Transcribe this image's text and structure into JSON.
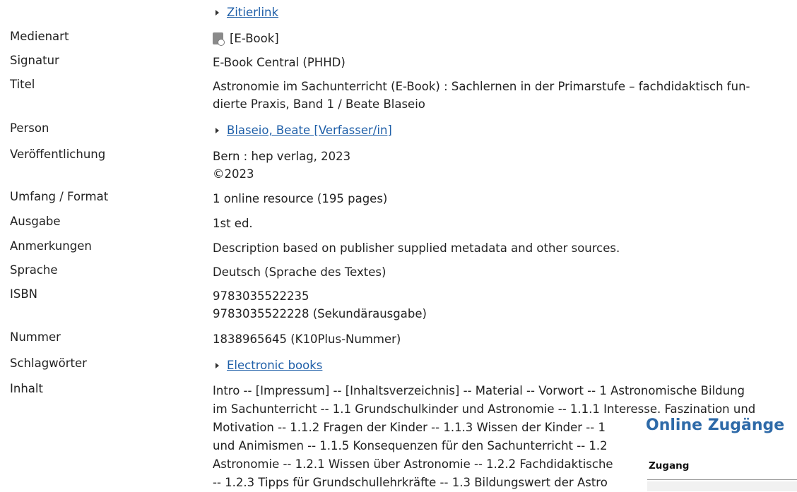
{
  "zitierlink": "Zitierlink",
  "fields": [
    {
      "label": "Medienart",
      "lines": [
        "[E-Book]"
      ],
      "icon": "ebook-icon"
    },
    {
      "label": "Signatur",
      "lines": [
        "E-Book Central (PHHD)"
      ]
    },
    {
      "label": "Titel",
      "lines": [
        "Astronomie im Sachunterricht (E-Book) : Sachlernen in der Primarstufe – fachdidaktisch fun-",
        "dierte Praxis, Band 1 / Beate Blaseio"
      ]
    },
    {
      "label": "Person",
      "link": "Blaseio, Beate [Verfasser/in]"
    },
    {
      "label": "Veröffentlichung",
      "lines": [
        "Bern : hep verlag, 2023",
        "©2023"
      ]
    },
    {
      "label": "Umfang / Format",
      "lines": [
        "1 online resource (195 pages)"
      ]
    },
    {
      "label": "Ausgabe",
      "lines": [
        "1st ed."
      ]
    },
    {
      "label": "Anmerkungen",
      "lines": [
        "Description based on publisher supplied metadata and other sources."
      ]
    },
    {
      "label": "Sprache",
      "lines": [
        "Deutsch (Sprache des Textes)"
      ]
    },
    {
      "label": "ISBN",
      "lines": [
        "9783035522235",
        "9783035522228 (Sekundärausgabe)"
      ]
    },
    {
      "label": "Nummer",
      "lines": [
        "1838965645 (K10Plus-Nummer)"
      ]
    },
    {
      "label": "Schlagwörter",
      "link": "Electronic books"
    },
    {
      "label": "Inhalt"
    }
  ],
  "inhalt_lines": [
    "Intro -- [Impressum] -- [Inhaltsverzeichnis] -- Material -- Vorwort -- 1 Astronomische Bildung",
    "im Sachunterricht -- 1.1 Grundschulkinder und Astronomie -- 1.1.1 Interesse. Faszination und",
    "Motivation -- 1.1.2 Fragen der Kinder -- 1.1.3 Wissen der Kinder -- 1",
    "und Animismen -- 1.1.5 Konsequenzen für den Sachunterricht -- 1.2",
    "Astronomie -- 1.2.1 Wissen über Astronomie -- 1.2.2 Fachdidaktische",
    "-- 1.2.3 Tipps für Grundschullehrkräfte -- 1.3 Bildungswert der Astro"
  ],
  "panel": {
    "title": "Online Zugänge",
    "column_header": "Zugang"
  }
}
